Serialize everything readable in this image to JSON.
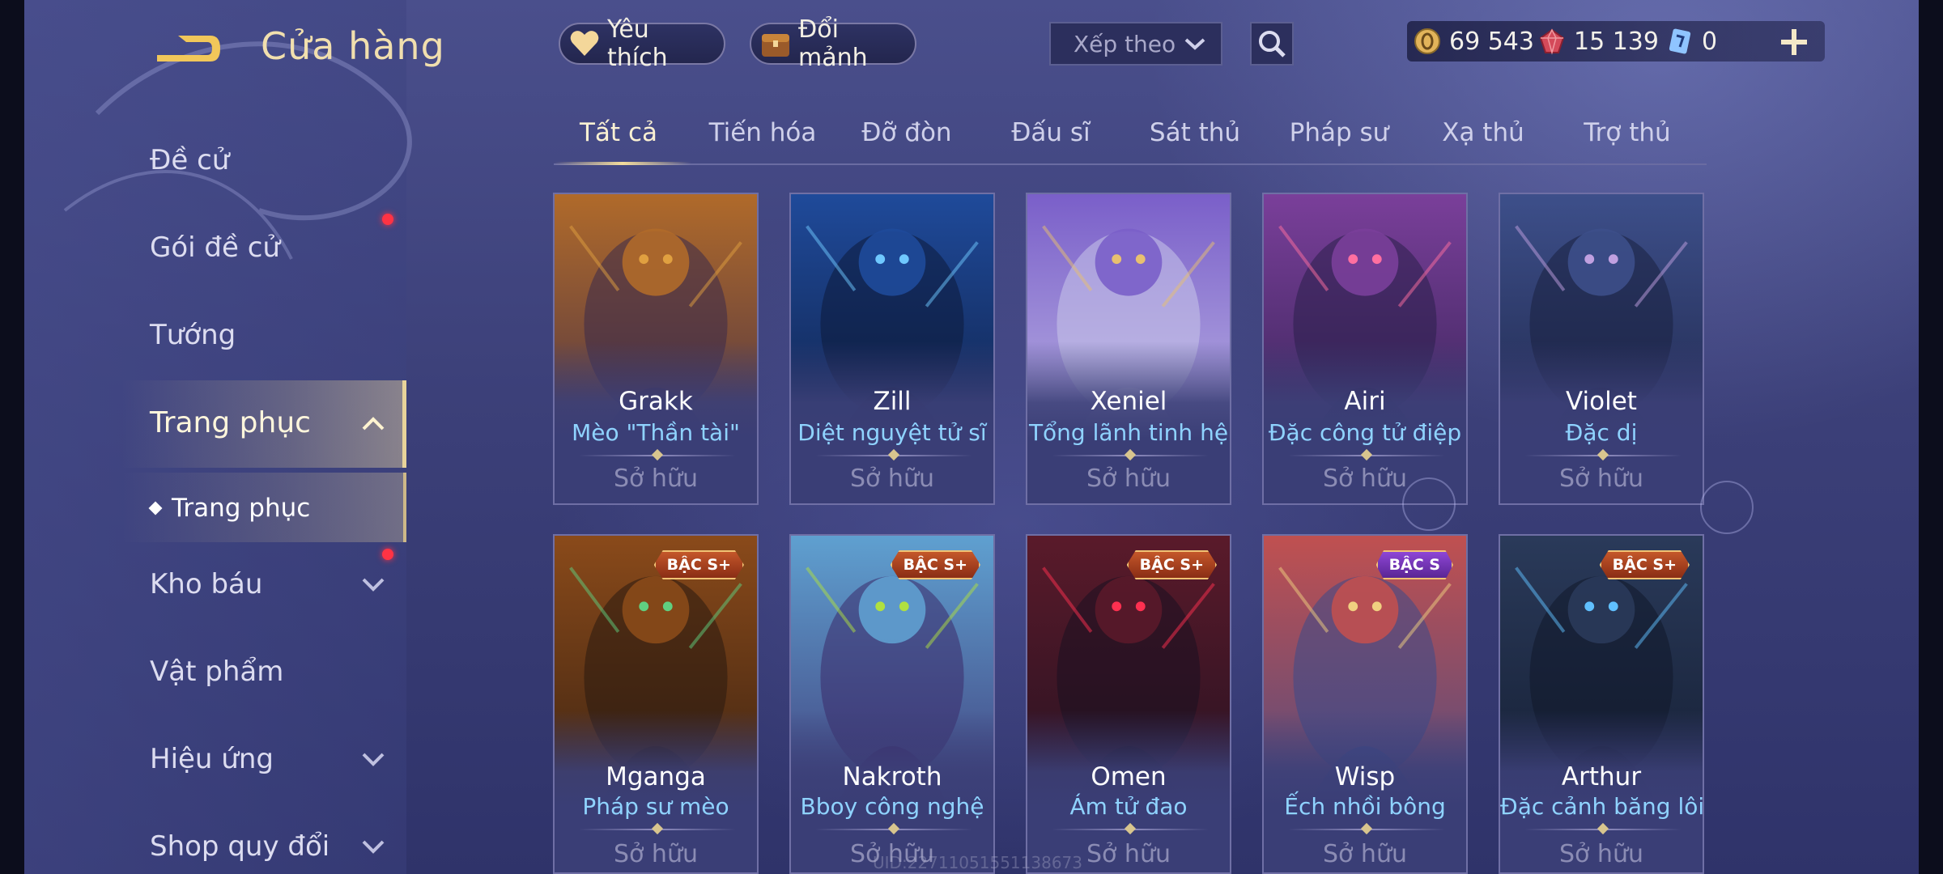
{
  "header": {
    "title": "Cửa hàng",
    "favorites_label": "Yêu thích",
    "shards_label": "Đổi mảnh",
    "sort_label": "Xếp theo"
  },
  "currency": {
    "gold": "69 543",
    "ruby": "15 139",
    "voucher": "0"
  },
  "sidebar": {
    "items": [
      {
        "label": "Đề cử"
      },
      {
        "label": "Gói đề cử"
      },
      {
        "label": "Tướng"
      },
      {
        "label": "Trang phục"
      },
      {
        "label": "Kho báu"
      },
      {
        "label": "Vật phẩm"
      },
      {
        "label": "Hiệu ứng"
      },
      {
        "label": "Shop quy đổi"
      }
    ],
    "sub_item": "Trang phục"
  },
  "tabs": [
    "Tất cả",
    "Tiến hóa",
    "Đỡ đòn",
    "Đấu sĩ",
    "Sát thủ",
    "Pháp sư",
    "Xạ thủ",
    "Trợ thủ"
  ],
  "cards": [
    {
      "hero": "Grakk",
      "skin": "Mèo \"Thần tài\"",
      "status": "Sở hữu",
      "art": [
        "#b06a2a",
        "#3b2a4a",
        "#e0a040"
      ]
    },
    {
      "hero": "Zill",
      "skin": "Diệt nguyệt tử sĩ",
      "status": "Sở hữu",
      "art": [
        "#1f4a9a",
        "#0d1a3a",
        "#6fc8ff"
      ]
    },
    {
      "hero": "Xeniel",
      "skin": "Tổng lãnh tinh hệ",
      "status": "Sở hữu",
      "art": [
        "#7a5fc9",
        "#c9c6ea",
        "#e8c070"
      ]
    },
    {
      "hero": "Airi",
      "skin": "Đặc công tử điệp",
      "status": "Sở hữu",
      "art": [
        "#7a3f9a",
        "#2a1f4a",
        "#ff6fa0"
      ]
    },
    {
      "hero": "Violet",
      "skin": "Đặc dị",
      "status": "Sở hữu",
      "art": [
        "#3d4f8a",
        "#1a2040",
        "#c0a0e0"
      ]
    },
    {
      "hero": "Mganga",
      "skin": "Pháp sư mèo",
      "status": "Sở hữu",
      "tier": "BẬC S+",
      "tier_color": "orange",
      "art": [
        "#8a4a1a",
        "#2a1a10",
        "#60d080"
      ]
    },
    {
      "hero": "Nakroth",
      "skin": "Bboy công nghệ",
      "status": "Sở hữu",
      "tier": "BẬC S+",
      "tier_color": "orange",
      "art": [
        "#5fa0d0",
        "#3a2a6a",
        "#b0e040"
      ]
    },
    {
      "hero": "Omen",
      "skin": "Ám tử đao",
      "status": "Sở hữu",
      "tier": "BẬC S+",
      "tier_color": "orange",
      "art": [
        "#5a1a2a",
        "#1a1020",
        "#ff3050"
      ]
    },
    {
      "hero": "Wisp",
      "skin": "Ếch nhồi bông",
      "status": "Sở hữu",
      "tier": "BẬC S",
      "tier_color": "purple",
      "art": [
        "#c05050",
        "#3a4a8a",
        "#f0d080"
      ]
    },
    {
      "hero": "Arthur",
      "skin": "Đặc cảnh băng lôi",
      "status": "Sở hữu",
      "tier": "BẬC S+",
      "tier_color": "orange",
      "art": [
        "#2a3a5a",
        "#10182a",
        "#60c0ff"
      ]
    }
  ],
  "uid_text": "UID:22711051551138673",
  "colors": {
    "accent_gold": "#f1dfae",
    "skin_name_blue": "#8fd3ff",
    "notification_red": "#ff3344"
  }
}
